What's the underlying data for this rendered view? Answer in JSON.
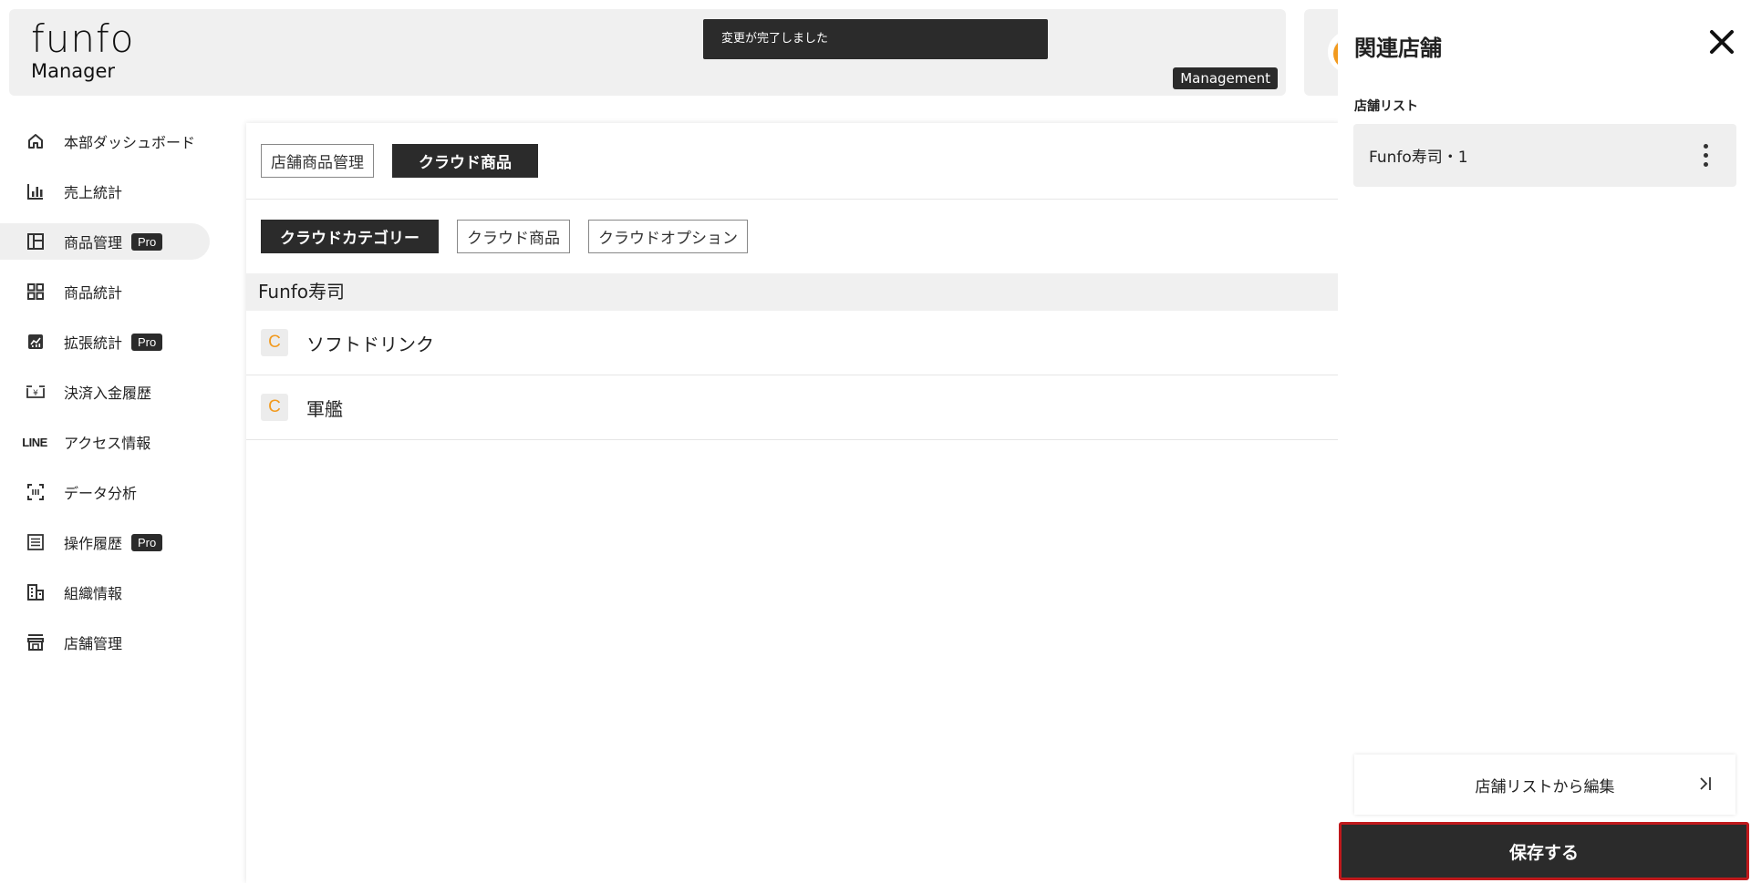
{
  "header": {
    "logo_main": "funfo",
    "logo_sub": "Manager",
    "toast": "変更が完了しました",
    "role_badge": "Management"
  },
  "sidebar": {
    "items": [
      {
        "label": "本部ダッシュボード",
        "icon": "home-icon",
        "pro": false,
        "active": false
      },
      {
        "label": "売上統計",
        "icon": "bar-chart-icon",
        "pro": false,
        "active": false
      },
      {
        "label": "商品管理",
        "icon": "layout-icon",
        "pro": true,
        "active": true
      },
      {
        "label": "商品統計",
        "icon": "grid-icon",
        "pro": false,
        "active": false
      },
      {
        "label": "拡張統計",
        "icon": "analytics-icon",
        "pro": true,
        "active": false
      },
      {
        "label": "決済入金履歴",
        "icon": "payment-icon",
        "pro": false,
        "active": false
      },
      {
        "label": "アクセス情報",
        "icon": "line-icon",
        "pro": false,
        "active": false
      },
      {
        "label": "データ分析",
        "icon": "scan-icon",
        "pro": false,
        "active": false
      },
      {
        "label": "操作履歴",
        "icon": "list-icon",
        "pro": true,
        "active": false
      },
      {
        "label": "組織情報",
        "icon": "building-icon",
        "pro": false,
        "active": false
      },
      {
        "label": "店舗管理",
        "icon": "store-icon",
        "pro": false,
        "active": false
      }
    ],
    "pro_label": "Pro",
    "line_text": "LINE"
  },
  "main": {
    "top_tabs": [
      {
        "label": "店舗商品管理",
        "active": false
      },
      {
        "label": "クラウド商品",
        "active": true
      }
    ],
    "sub_tabs": [
      {
        "label": "クラウドカテゴリー",
        "active": true
      },
      {
        "label": "クラウド商品",
        "active": false
      },
      {
        "label": "クラウドオプション",
        "active": false
      }
    ],
    "group_name": "Funfo寿司",
    "categories": [
      {
        "badge": "C",
        "name": "ソフトドリンク"
      },
      {
        "badge": "C",
        "name": "軍艦"
      }
    ]
  },
  "drawer": {
    "title": "関連店舗",
    "list_label": "店舗リスト",
    "stores": [
      {
        "name": "Funfo寿司・1"
      }
    ],
    "edit_label": "店舗リストから編集",
    "save_label": "保存する"
  },
  "colors": {
    "accent_dark": "#2b2b2b",
    "category_badge": "#f29a1e",
    "save_border": "#c0191c"
  }
}
